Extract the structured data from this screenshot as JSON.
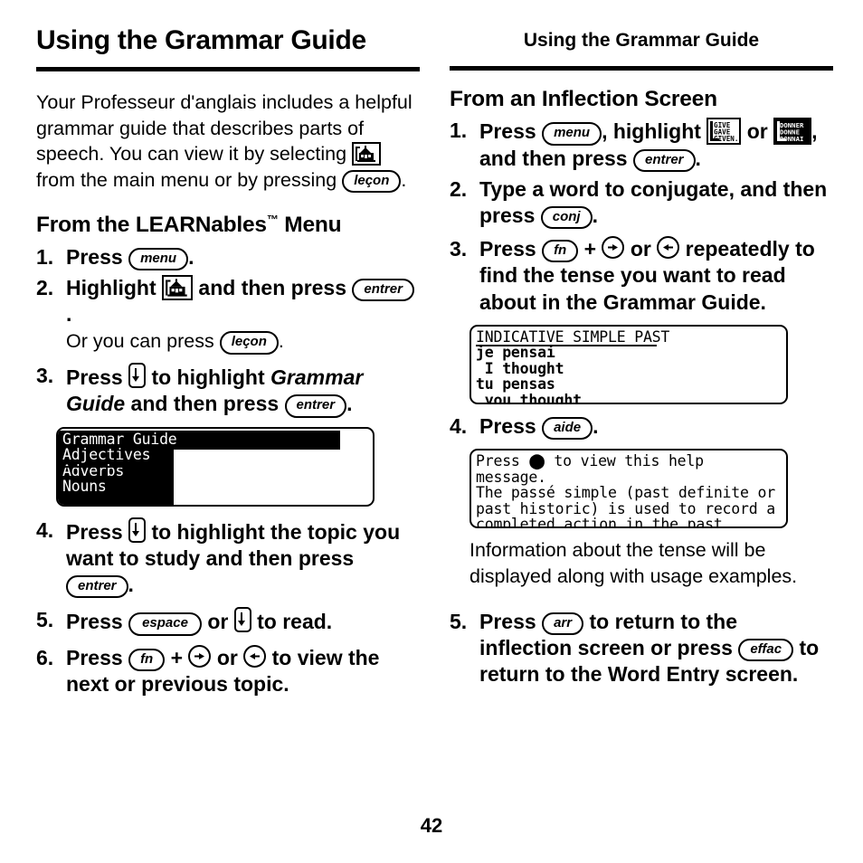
{
  "page": {
    "number": "42",
    "left_header": "Using the Grammar Guide",
    "right_header": "Using the Grammar Guide"
  },
  "left_column": {
    "intro_paragraph": {
      "part1": "Your Professeur d'anglais includes a helpful grammar guide that describes parts of speech. You can view it by selecting ",
      "icon": "learnables-schoolhouse-icon",
      "part2": " from the main menu or by pressing ",
      "key": "leçon",
      "part3": "."
    },
    "section_heading": "From the LEARNables",
    "section_heading_sup": "™",
    "section_heading_tail": " Menu",
    "steps": [
      {
        "num": "1.",
        "part1": "Press ",
        "key1": "menu",
        "part2": "."
      },
      {
        "num": "2.",
        "part1": "Highlight ",
        "icon": "learnables-schoolhouse-icon",
        "part2": " and then press ",
        "key1": "entrer",
        "part3": ".",
        "subnote_part1": "Or you can press ",
        "subnote_key": "leçon",
        "subnote_part2": "."
      },
      {
        "num": "3.",
        "part1": "Press ",
        "keyicon": "down-arrow-key",
        "part2": " to highlight ",
        "italic": "Grammar Guide",
        "part3": " and then press ",
        "key1": "entrer",
        "part4": "."
      },
      {
        "num": "4.",
        "part1": "Press ",
        "keyicon": "down-arrow-key",
        "part2": " to highlight the topic you want to study and then press ",
        "key1": "entrer",
        "part3": "."
      },
      {
        "num": "5.",
        "part1": "Press ",
        "key1": "espace",
        "part2": " or ",
        "keyicon": "down-arrow-key",
        "part3": " to read."
      },
      {
        "num": "6.",
        "part1": "Press ",
        "key1": "fn",
        "part2": " + ",
        "keyicon1": "right-arrow-key",
        "part3": " or ",
        "keyicon2": "left-arrow-key",
        "part4": " to view the next or previous topic."
      }
    ],
    "lcd_menu": {
      "title": "Grammar Guide",
      "items": [
        {
          "label": "Adjectives",
          "selected": true
        },
        {
          "label": "Adverbs",
          "selected": false
        },
        {
          "label": "Nouns",
          "selected": false
        }
      ]
    }
  },
  "right_column": {
    "section_heading": "From an Inflection Screen",
    "steps": [
      {
        "num": "1.",
        "part1": "Press ",
        "key1": "menu",
        "part2": ", highlight ",
        "icon1": "give-gave-given-icon",
        "part3": " or ",
        "icon2": "donner-donne-donna-icon",
        "part4": ", and then press ",
        "key2": "entrer",
        "part5": "."
      },
      {
        "num": "2.",
        "part1": "Type a word to conjugate, and then press ",
        "key1": "conj",
        "part2": "."
      },
      {
        "num": "3.",
        "part1": "Press ",
        "key1": "fn",
        "part2": " + ",
        "keyicon1": "right-arrow-key",
        "part3": " or ",
        "keyicon2": "left-arrow-key",
        "part4": " repeatedly to find the tense you want to read about in the Grammar Guide."
      },
      {
        "num": "4.",
        "part1": "Press ",
        "key1": "aide",
        "part2": "."
      },
      {
        "num": "5.",
        "part1": "Press ",
        "key1": "arr",
        "part2": " to return to the inflection screen or press ",
        "key2": "effac",
        "part3": " to return to the Word Entry screen."
      }
    ],
    "lcd_inflection": {
      "lines": [
        {
          "text": "INDICATIVE SIMPLE PAST",
          "bold": false
        },
        {
          "text": "je pensai",
          "bold": true
        },
        {
          "text": " I thought",
          "bold": true
        },
        {
          "text": "tu pensas",
          "bold": true
        },
        {
          "text": " you thought",
          "bold": true
        }
      ]
    },
    "lcd_help": {
      "lines": [
        {
          "text": "Press ⬤ to view this help"
        },
        {
          "text": "message."
        },
        {
          "text": "The passé simple (past definite or"
        },
        {
          "text": "past historic) is used to record a"
        },
        {
          "text": "completed action in the past."
        }
      ]
    },
    "note_paragraph": "Information about the tense will be displayed along with usage examples."
  },
  "icon_glyph_text": {
    "give_gave_given": [
      "GIVE",
      "GAVE",
      "GIVEN"
    ],
    "donner": [
      "DONNER",
      "DONNE",
      "DONNAI"
    ]
  },
  "colors": {
    "ink": "#000000",
    "paper": "#ffffff"
  }
}
